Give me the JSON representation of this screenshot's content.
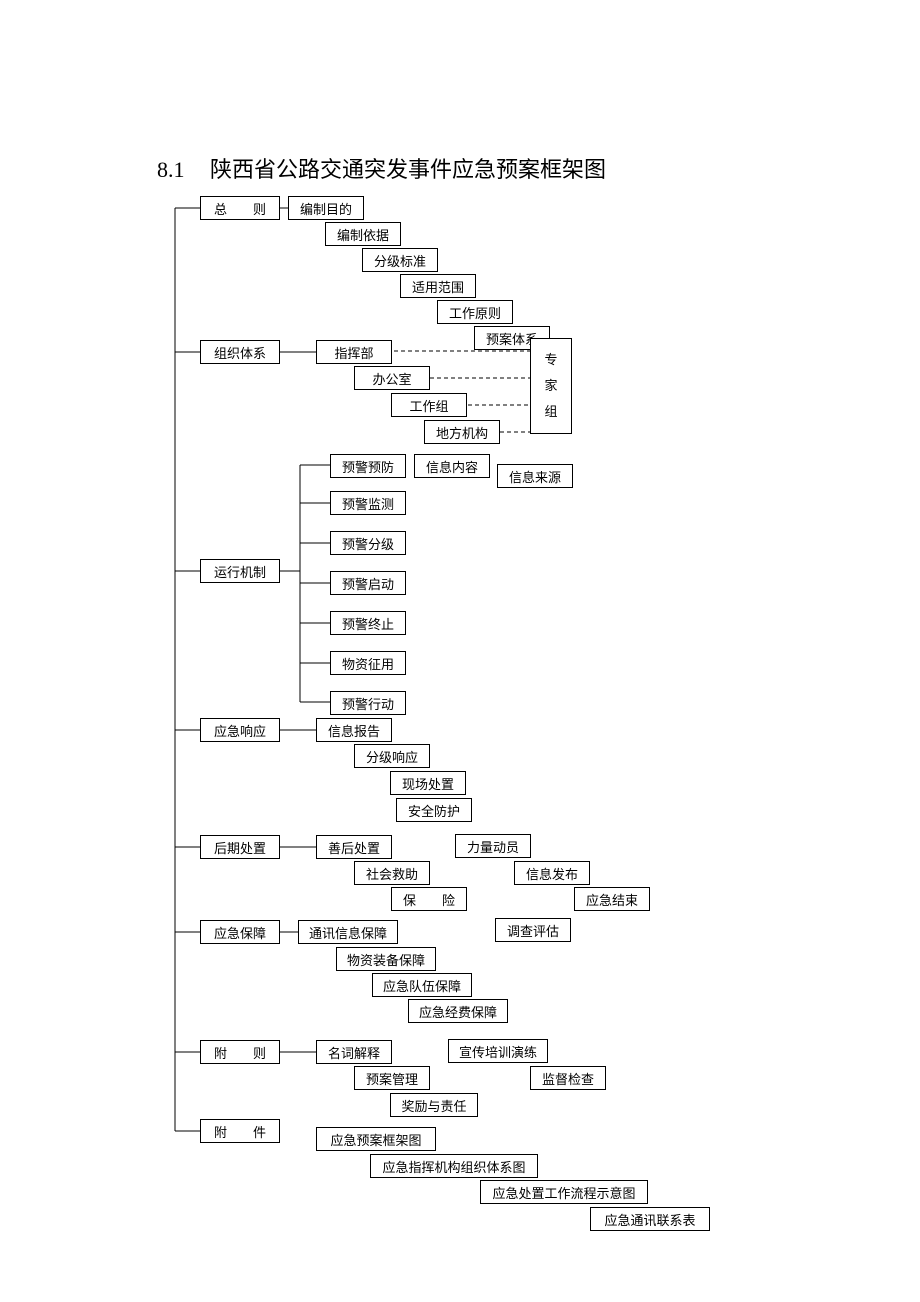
{
  "title_number": "8.1",
  "title_text": "陕西省公路交通突发事件应急预案框架图",
  "sections": {
    "s1": "总　　则",
    "s2": "组织体系",
    "s3": "运行机制",
    "s4": "应急响应",
    "s5": "后期处置",
    "s6": "应急保障",
    "s7": "附　　则",
    "s8": "附　　件"
  },
  "s1_items": {
    "a": "编制目的",
    "b": "编制依据",
    "c": "分级标准",
    "d": "适用范围",
    "e": "工作原则",
    "f": "预案体系"
  },
  "s2_items": {
    "a": "指挥部",
    "b": "办公室",
    "c": "工作组",
    "d": "地方机构"
  },
  "expert_group": {
    "l1": "专",
    "l2": "家",
    "l3": "组"
  },
  "s3_items": {
    "a": "预警预防",
    "b": "预警监测",
    "c": "预警分级",
    "d": "预警启动",
    "e": "预警终止",
    "f": "物资征用",
    "g": "预警行动"
  },
  "s3_sub": {
    "a": "信息内容",
    "b": "信息来源"
  },
  "s4_items": {
    "a": "信息报告",
    "b": "分级响应",
    "c": "现场处置",
    "d": "安全防护",
    "e": "力量动员",
    "f": "信息发布",
    "g": "应急结束",
    "h": "调查评估"
  },
  "s5_items": {
    "a": "善后处置",
    "b": "社会救助",
    "c": "保　　险"
  },
  "s6_items": {
    "a": "通讯信息保障",
    "b": "物资装备保障",
    "c": "应急队伍保障",
    "d": "应急经费保障",
    "e": "宣传培训演练",
    "f": "监督检查"
  },
  "s7_items": {
    "a": "名词解释",
    "b": "预案管理",
    "c": "奖励与责任"
  },
  "s8_items": {
    "a": "应急预案框架图",
    "b": "应急指挥机构组织体系图",
    "c": "应急处置工作流程示意图",
    "d": "应急通讯联系表"
  }
}
